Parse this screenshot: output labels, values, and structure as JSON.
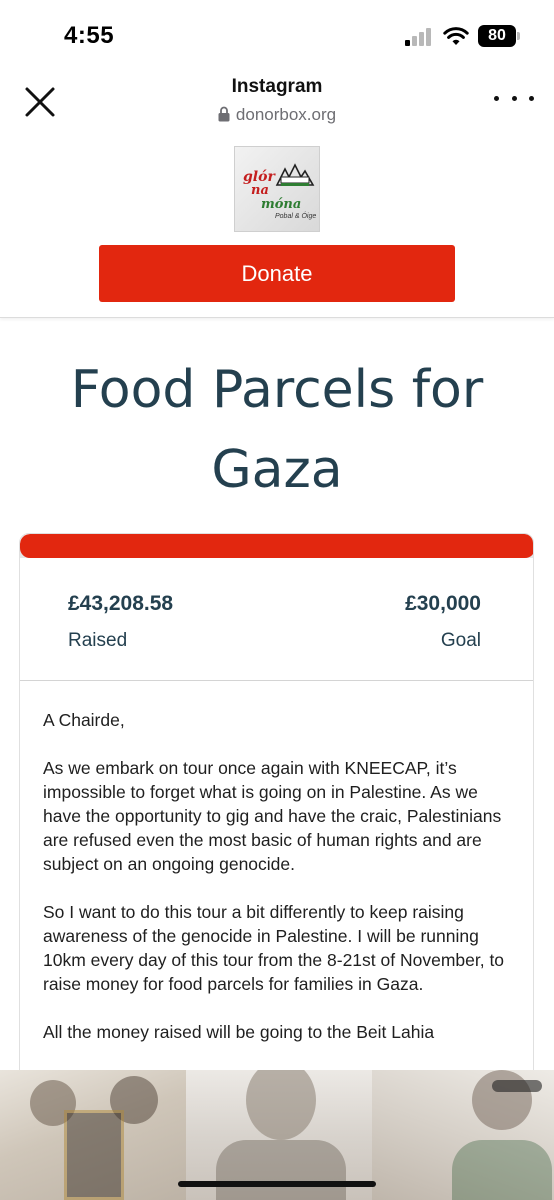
{
  "status_bar": {
    "time": "4:55",
    "battery": "80"
  },
  "browser": {
    "title": "Instagram",
    "url": "donorbox.org",
    "close_icon": "close-icon",
    "more_icon": "more-horizontal-icon",
    "lock_icon": "lock-icon"
  },
  "header": {
    "logo": {
      "line1": "glór",
      "line2": "na",
      "line3": "móna",
      "subtitle": "Pobal & Óige"
    },
    "donate_label": "Donate",
    "accent_color": "#e2270f"
  },
  "campaign": {
    "title": "Food Parcels for Gaza",
    "raised_amount": "£43,208.58",
    "raised_label": "Raised",
    "goal_amount": "£30,000",
    "goal_label": "Goal",
    "progress_fraction": 1.0,
    "description": [
      "A Chairde,",
      "As we embark on tour once again with KNEECAP, it’s impossible to forget what is going on in Palestine. As we have the opportunity to gig and have the craic, Palestinians are refused even the most basic of human rights and are subject on an ongoing genocide.",
      "So I want to do this tour a bit differently to keep raising awareness of the genocide in Palestine. I will be running 10km every day of this tour from the 8-21st of November, to raise money for food parcels for families in Gaza.",
      "All the money raised will be going to the Beit Lahia"
    ]
  }
}
